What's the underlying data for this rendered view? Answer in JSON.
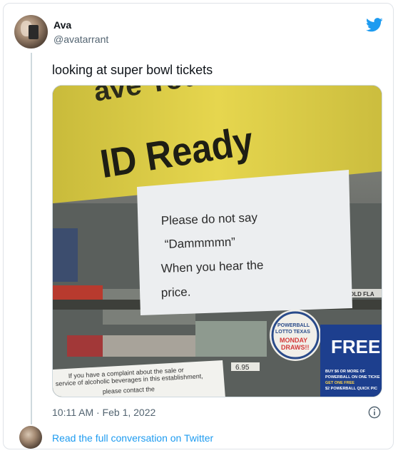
{
  "tweet": {
    "display_name": "Ava",
    "handle": "@avatarrant",
    "text": "looking at super bowl tickets",
    "timestamp": "10:11 AM · Feb 1, 2022"
  },
  "footer": {
    "link_text": "Read the full conversation on Twitter"
  },
  "photo": {
    "banner_top": "ave You",
    "banner_main": "ID Ready",
    "note_line1": "Please do not say",
    "note_line2": "“Dammmmn”",
    "note_line3": "When you hear the",
    "note_line4": "price.",
    "badge_line1": "POWERBALL",
    "badge_line2": "LOTTO TEXAS",
    "badge_line3": "MONDAY",
    "badge_line4": "DRAWS!!",
    "free_sign": "FREE",
    "promo_line1": "BUY $6 OR MORE OF",
    "promo_line2": "POWERBALL ON ONE TICKE",
    "promo_line3": "GET ONE FREE",
    "promo_line4": "$2 POWERBALL QUICK PIC",
    "complaint_line1": "If you have a complaint about the sale or",
    "complaint_line2": "service of alcoholic beverages in this establishment,",
    "complaint_line3": "please contact the",
    "price_tag": "6.95",
    "old_sign": "OLD FLA"
  },
  "colors": {
    "link": "#1d9bf0",
    "twitter_blue": "#1d9bf0",
    "secondary_text": "#536471",
    "sign_yellow": "#e3d24a"
  },
  "icons": {
    "logo": "twitter-bird-icon",
    "info": "info-icon"
  }
}
